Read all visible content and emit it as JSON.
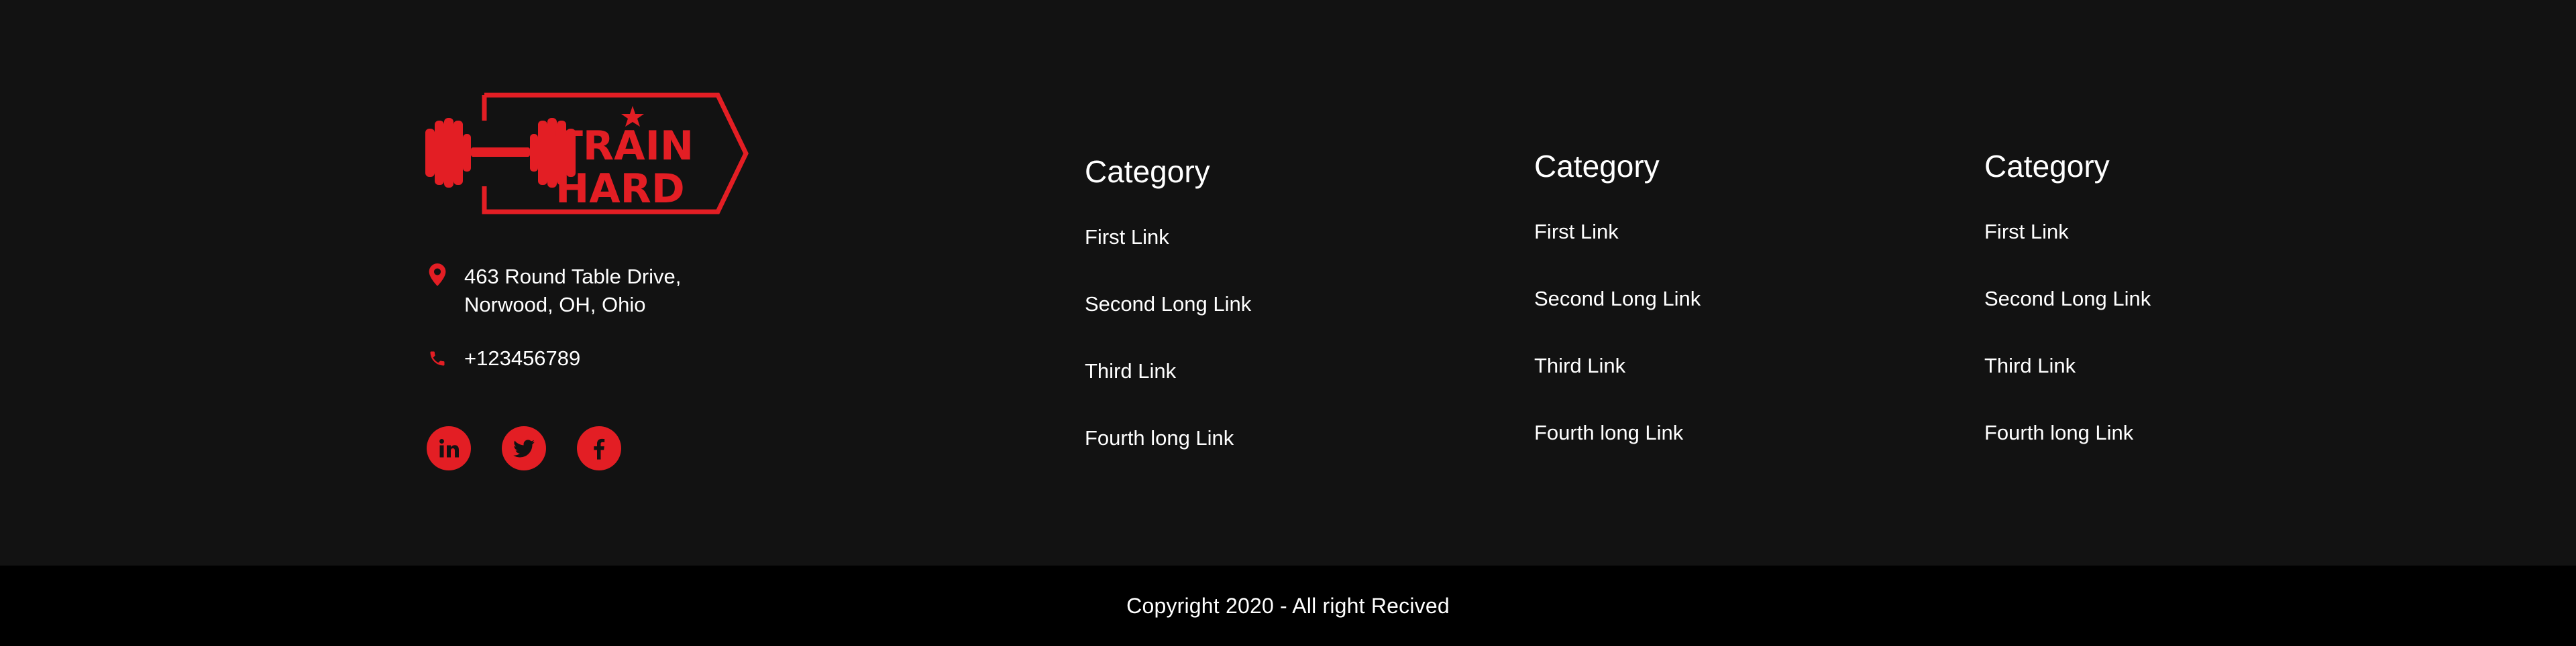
{
  "brand": {
    "logo_line1": "TRAIN",
    "logo_line2": "HARD",
    "accent_color": "#e31e24"
  },
  "contact": {
    "address_line1": "463 Round Table Drive,",
    "address_line2": "Norwood, OH, Ohio",
    "phone": "+123456789",
    "address_icon": "map-pin-icon",
    "phone_icon": "phone-icon"
  },
  "socials": [
    {
      "icon": "linkedin-icon"
    },
    {
      "icon": "twitter-icon"
    },
    {
      "icon": "facebook-icon"
    }
  ],
  "columns": [
    {
      "title": "Category",
      "links": [
        "First Link",
        "Second Long Link",
        "Third Link",
        "Fourth long Link"
      ]
    },
    {
      "title": "Category",
      "links": [
        "First Link",
        "Second Long Link",
        "Third Link",
        "Fourth long Link"
      ]
    },
    {
      "title": "Category",
      "links": [
        "First Link",
        "Second Long Link",
        "Third Link",
        "Fourth long Link"
      ]
    }
  ],
  "footer": {
    "copyright": "Copyright 2020 - All right Recived"
  },
  "colors": {
    "background": "#121212",
    "bottom_bar": "#000000",
    "text": "#ffffff"
  }
}
